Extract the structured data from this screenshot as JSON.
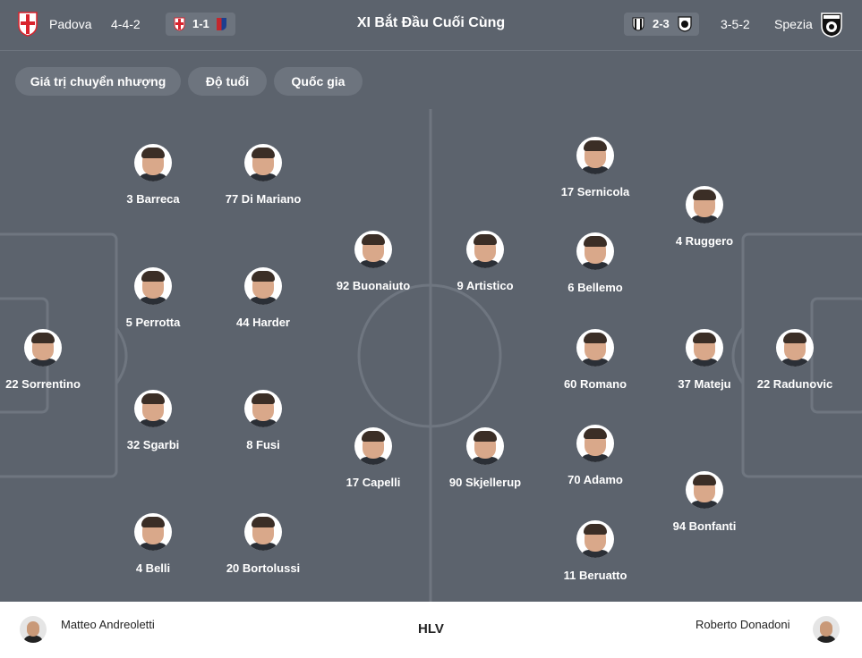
{
  "header": {
    "home_team": "Padova",
    "home_formation": "4-4-2",
    "home_score": "1-1",
    "title": "XI Bắt Đầu Cuối Cùng",
    "away_score": "2-3",
    "away_formation": "3-5-2",
    "away_team": "Spezia"
  },
  "filters": [
    {
      "label": "Giá trị chuyển nhượng"
    },
    {
      "label": "Độ tuổi"
    },
    {
      "label": "Quốc gia"
    }
  ],
  "home_players": [
    {
      "label": "22 Sorrentino"
    },
    {
      "label": "3 Barreca"
    },
    {
      "label": "5 Perrotta"
    },
    {
      "label": "32 Sgarbi"
    },
    {
      "label": "4 Belli"
    },
    {
      "label": "77 Di Mariano"
    },
    {
      "label": "44 Harder"
    },
    {
      "label": "8 Fusi"
    },
    {
      "label": "20 Bortolussi"
    },
    {
      "label": "92 Buonaiuto"
    },
    {
      "label": "17 Capelli"
    }
  ],
  "away_players": [
    {
      "label": "9 Artistico"
    },
    {
      "label": "90 Skjellerup"
    },
    {
      "label": "17 Sernicola"
    },
    {
      "label": "6 Bellemo"
    },
    {
      "label": "60 Romano"
    },
    {
      "label": "70 Adamo"
    },
    {
      "label": "11 Beruatto"
    },
    {
      "label": "4 Ruggero"
    },
    {
      "label": "37 Mateju"
    },
    {
      "label": "94 Bonfanti"
    },
    {
      "label": "22 Radunovic"
    }
  ],
  "footer": {
    "home_coach": "Matteo Andreoletti",
    "label": "HLV",
    "away_coach": "Roberto Donadoni"
  },
  "colors": {
    "panel": "#5c636d",
    "chip": "#6d747e",
    "home_red": "#d9232d",
    "away_black": "#111111"
  }
}
